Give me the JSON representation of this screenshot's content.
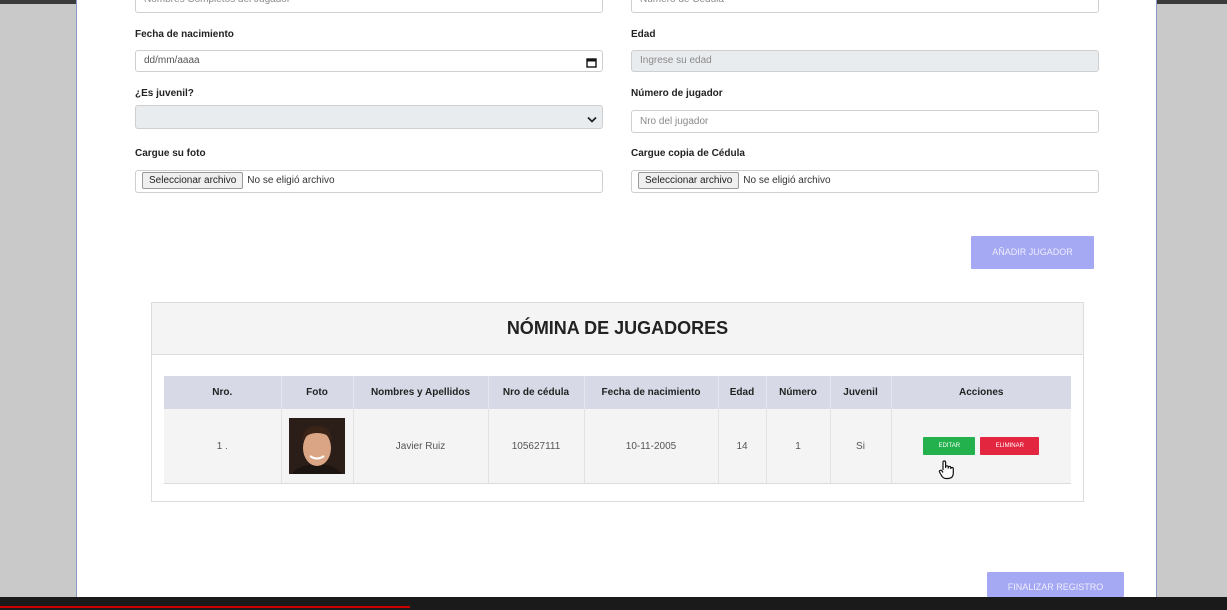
{
  "form": {
    "nombre_placeholder": "Nombres Completos del Jugador",
    "cedula_placeholder": "Número de Cédula",
    "fecha_label": "Fecha de nacimiento",
    "fecha_value": "dd/mm/aaaa",
    "edad_label": "Edad",
    "edad_placeholder": "Ingrese su edad",
    "juvenil_label": "¿Es juvenil?",
    "juvenil_value": "",
    "numero_label": "Número de jugador",
    "numero_placeholder": "Nro del jugador",
    "foto_label": "Cargue su foto",
    "cedula_copia_label": "Cargue copia de Cédula",
    "file_button": "Seleccionar archivo",
    "file_none": "No se eligió archivo",
    "add_button": "AÑADIR JUGADOR"
  },
  "nomina": {
    "title": "NÓMINA DE JUGADORES",
    "columns": [
      "Nro.",
      "Foto",
      "Nombres y Apellidos",
      "Nro de cédula",
      "Fecha de nacimiento",
      "Edad",
      "Número",
      "Juvenil",
      "Acciones"
    ],
    "rows": [
      {
        "nro": "1 .",
        "nombre": "Javier Ruiz",
        "cedula": "105627111",
        "fecha": "10-11-2005",
        "edad": "14",
        "numero": "1",
        "juvenil": "Si",
        "edit_label": "EDITAR",
        "delete_label": "ELIMINAR"
      }
    ]
  },
  "finalizar_button": "FINALIZAR REGISTRO",
  "icons": {
    "calendar": "calendar-icon",
    "select_arrow": "chevron-down-icon",
    "cursor": "hand-pointer-icon"
  },
  "colors": {
    "purple_button": "#a5a8f2",
    "edit_green": "#22b14c",
    "delete_red": "#e2263f",
    "table_header": "#d7dae6"
  }
}
